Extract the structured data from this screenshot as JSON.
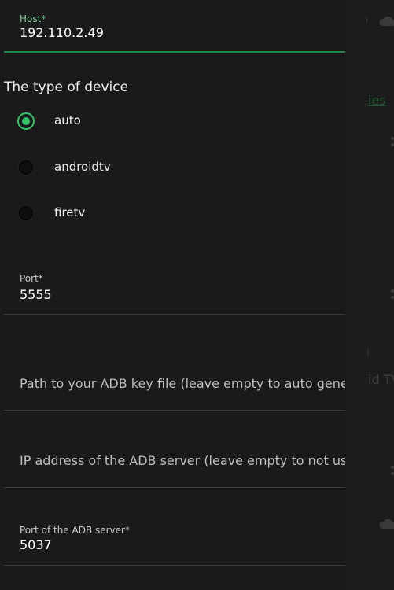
{
  "form": {
    "host": {
      "label": "Host*",
      "value": "192.110.2.49"
    },
    "device_type": {
      "title": "The type of device",
      "options": [
        {
          "label": "auto",
          "checked": true
        },
        {
          "label": "androidtv",
          "checked": false
        },
        {
          "label": "firetv",
          "checked": false
        }
      ]
    },
    "port": {
      "label": "Port*",
      "value": "5555"
    },
    "adb_key_path": {
      "placeholder": "Path to your ADB key file (leave empty to auto generate)"
    },
    "adb_server_ip": {
      "placeholder": "IP address of the ADB server (leave empty to not use)"
    },
    "adb_server_port": {
      "label": "Port of the ADB server*",
      "value": "5037"
    }
  },
  "background": {
    "link_fragment": "ies",
    "text_fragment": "id TV",
    "accent_color": "#33c46a"
  }
}
